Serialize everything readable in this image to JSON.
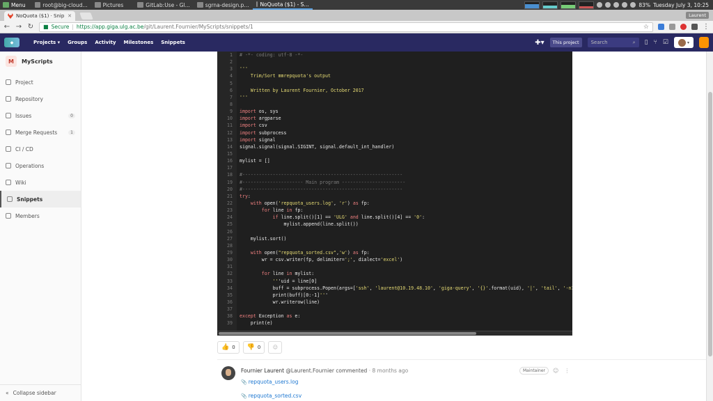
{
  "os": {
    "menu_label": "Menu",
    "tasks": [
      "root@big-cloud...",
      "Pictures",
      "GitLab:Use - Gl...",
      "sgrna-design.p...",
      "NoQuota ($1) - S..."
    ],
    "battery": "83%",
    "clock": "Tuesday July  3, 10:25"
  },
  "browser": {
    "tab_title": "NoQuota ($1) · Snippets",
    "user_badge": "Laurent",
    "secure_label": "Secure",
    "url_host": "https://app.giga.ulg.ac.be",
    "url_path": "/git/Laurent.Fournier/MyScripts/snippets/1"
  },
  "gitlab": {
    "nav": [
      "Projects",
      "Groups",
      "Activity",
      "Milestones",
      "Snippets"
    ],
    "scope_label": "This project",
    "search_placeholder": "Search"
  },
  "sidebar": {
    "project_initial": "M",
    "project_name": "MyScripts",
    "items": [
      {
        "label": "Project",
        "count": ""
      },
      {
        "label": "Repository",
        "count": ""
      },
      {
        "label": "Issues",
        "count": "0"
      },
      {
        "label": "Merge Requests",
        "count": "1"
      },
      {
        "label": "CI / CD",
        "count": ""
      },
      {
        "label": "Operations",
        "count": ""
      },
      {
        "label": "Wiki",
        "count": ""
      },
      {
        "label": "Snippets",
        "count": ""
      },
      {
        "label": "Members",
        "count": ""
      }
    ],
    "collapse_label": "Collapse sidebar"
  },
  "code": {
    "lines": [
      "# -*- coding: utf-8 -*-",
      "",
      "'''",
      "    Trim/Sort mmrepquota's output",
      "",
      "    Written by Laurent Fournier, October 2017",
      "'''",
      "",
      "import os, sys",
      "import argparse",
      "import csv",
      "import subprocess",
      "import signal",
      "signal.signal(signal.SIGINT, signal.default_int_handler)",
      "",
      "mylist = []",
      "",
      "#----------------------------------------------------------",
      "#---------------------- Main program -----------------------",
      "#----------------------------------------------------------",
      "try:",
      "    with open('repquota_users.log', 'r') as fp:",
      "        for line in fp:",
      "            if line.split()[1] == 'ULG' and line.split()[4] == '0':",
      "                mylist.append(line.split())",
      "",
      "    mylist.sort()",
      "",
      "    with open(\"repquota_sorted.csv\",'w') as fp:",
      "        wr = csv.writer(fp, delimiter=';', dialect='excel')",
      "",
      "        for line in mylist:",
      "            '''uid = line[0]",
      "            buff = subprocess.Popen(args=['ssh', 'laurent@10.19.48.10', 'giga-query', '{}'.format(uid), '|', 'tail', '-n1'],",
      "            print(buff)[0:-1]'''",
      "            wr.writerow(line)",
      "",
      "except Exception as e:",
      "    print(e)"
    ]
  },
  "awards": {
    "thumbs_up": "0",
    "thumbs_down": "0"
  },
  "comment": {
    "author": "Fournier Laurent",
    "handle": "@Laurent.Fournier",
    "action": "commented",
    "time": "· 8 months ago",
    "role": "Maintainer",
    "files": [
      "repquota_users.log",
      "repquota_sorted.csv"
    ]
  }
}
